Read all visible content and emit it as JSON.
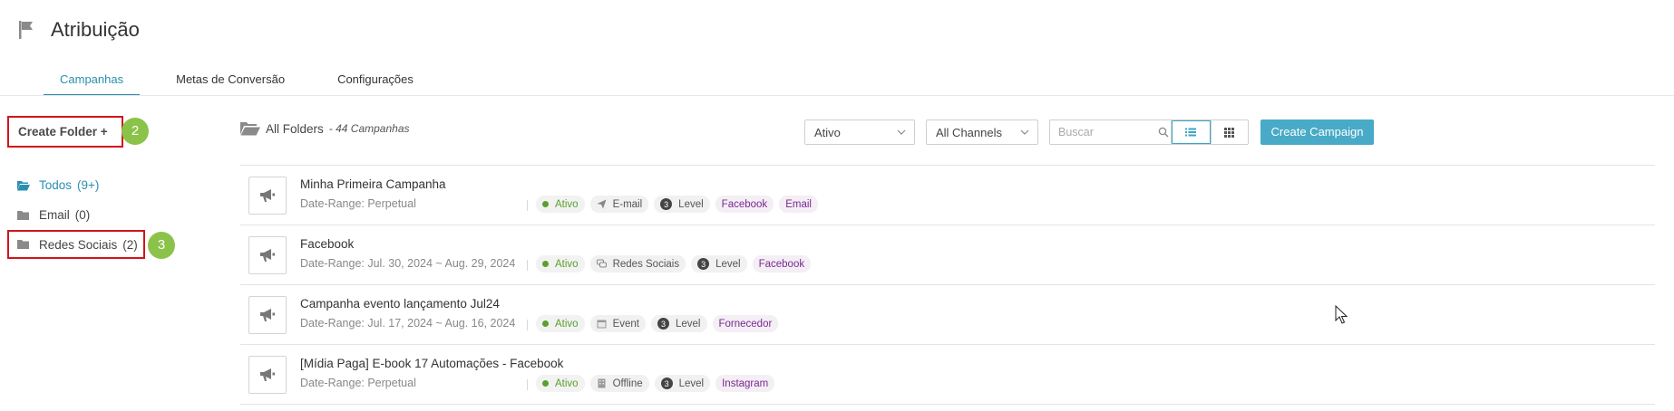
{
  "header": {
    "title": "Atribuição",
    "icon": "flag-icon"
  },
  "tabs": [
    {
      "label": "Campanhas",
      "active": true
    },
    {
      "label": "Metas de Conversão",
      "active": false
    },
    {
      "label": "Configurações",
      "active": false
    }
  ],
  "sidebar": {
    "create_folder_label": "Create Folder +",
    "badge_create": "2",
    "badge_folder": "3",
    "folders": [
      {
        "label": "Todos",
        "count": "(9+)",
        "active": true
      },
      {
        "label": "Email",
        "count": "(0)",
        "active": false
      },
      {
        "label": "Redes Sociais",
        "count": "(2)",
        "active": false
      }
    ]
  },
  "toolbar": {
    "all_folders_label": "All Folders",
    "campaign_count": "- 44 Campanhas",
    "status_select": "Ativo",
    "channel_select": "All Channels",
    "search_placeholder": "Buscar",
    "create_campaign_label": "Create Campaign"
  },
  "campaigns": [
    {
      "title": "Minha Primeira Campanha",
      "range": "Date-Range: Perpetual",
      "status": "Ativo",
      "channel": "E-mail",
      "channel_icon": "send-icon",
      "level": "3",
      "level_label": "Level",
      "tags": [
        "Facebook",
        "Email"
      ]
    },
    {
      "title": "Facebook",
      "range": "Date-Range: Jul. 30, 2024 ~ Aug. 29, 2024",
      "status": "Ativo",
      "channel": "Redes Sociais",
      "channel_icon": "chat-icon",
      "level": "3",
      "level_label": "Level",
      "tags": [
        "Facebook"
      ]
    },
    {
      "title": "Campanha evento lançamento Jul24",
      "range": "Date-Range: Jul. 17, 2024 ~ Aug. 16, 2024",
      "status": "Ativo",
      "channel": "Event",
      "channel_icon": "calendar-icon",
      "level": "3",
      "level_label": "Level",
      "tags": [
        "Fornecedor"
      ]
    },
    {
      "title": "[Mídia Paga] E-book 17 Automações - Facebook",
      "range": "Date-Range: Perpetual",
      "status": "Ativo",
      "channel": "Offline",
      "channel_icon": "building-icon",
      "level": "3",
      "level_label": "Level",
      "tags": [
        "Instagram"
      ]
    }
  ],
  "colors": {
    "accent": "#2a8fb0",
    "button": "#48aac6",
    "highlight_border": "#d0151c",
    "badge": "#8bc34a",
    "status_green": "#5aa02c",
    "tag_purple": "#7a2a8f"
  }
}
